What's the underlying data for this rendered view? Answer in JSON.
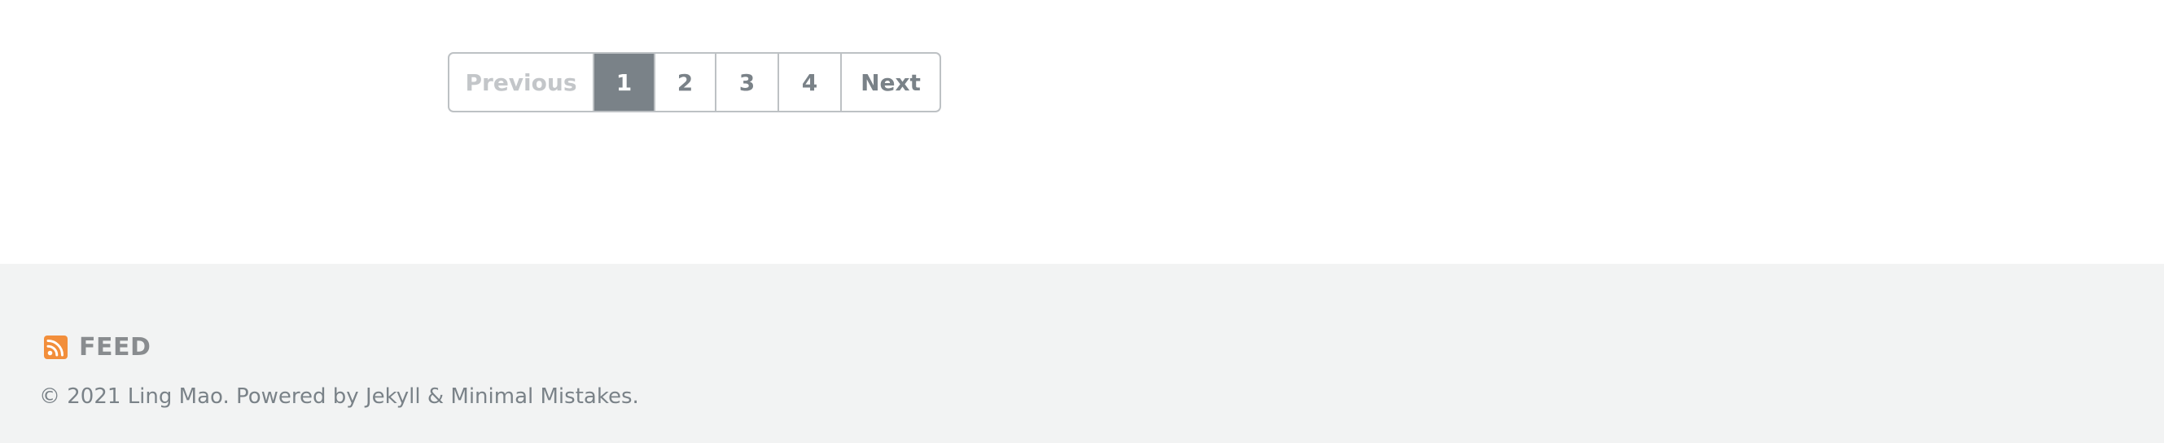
{
  "pagination": {
    "previous_label": "Previous",
    "pages": [
      "1",
      "2",
      "3",
      "4"
    ],
    "current_page": "1",
    "next_label": "Next"
  },
  "footer": {
    "feed_label": "FEED",
    "feed_icon": "rss-icon",
    "feed_icon_color": "#f28e3b",
    "copyright": "© 2021 Ling Mao. Powered by Jekyll & Minimal Mistakes."
  },
  "colors": {
    "footer_background": "#f2f3f3",
    "active_page_background": "#7a8288",
    "border": "#bdc1c4"
  }
}
